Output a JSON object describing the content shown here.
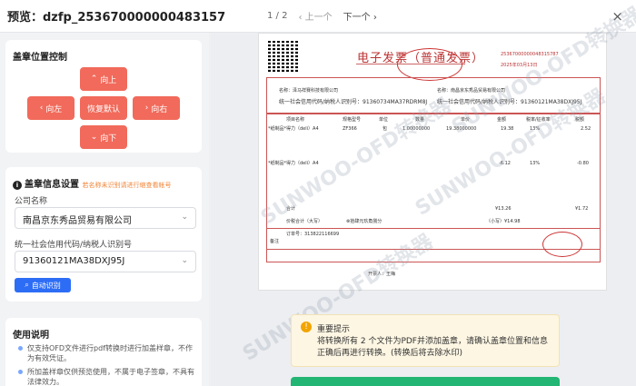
{
  "header": {
    "title": "预览：dzfp_25367000000048315787_南...",
    "page": "1 / 2",
    "prev": "‹ 上一个",
    "next": "下一个 ›",
    "close": "×"
  },
  "stamp_control": {
    "title": "盖章位置控制",
    "up": "向上",
    "left": "向左",
    "reset": "恢复默认",
    "right": "向右",
    "down": "向下"
  },
  "seal_info": {
    "title": "盖章信息设置",
    "hint": "若名称未识别请进行缩查看帐号",
    "company_label": "公司名称",
    "company_value": "南昌京东秀品贸易有限公司",
    "credit_label": "统一社会信用代码/纳税人识别号",
    "credit_value": "91360121MA38DXJ95J",
    "auto_label": "自动识别"
  },
  "instructions": {
    "title": "使用说明",
    "items": [
      "仅支持OFD文件进行pdf转换时进行加盖样章，不作为有效凭证。",
      "所加盖样章仅供预览使用，不属于电子签章，不具有法律效力。"
    ]
  },
  "invoice": {
    "title": "电子发票（普通发票）",
    "number": "25367000000048315787",
    "date": "2025年03月13日",
    "buyer_name": "名称：泽马祥赛科技有限公司",
    "buyer_tax": "统一社会信用代码/纳税人识别号：91360734MA37RDRM8J",
    "seller_name": "名称：南昌京东秀品贸易有限公司",
    "seller_tax": "统一社会信用代码/纳税人识别号：91360121MA38DXJ95J",
    "col_item": "项目名称",
    "col_spec": "规格型号",
    "col_unit": "单位",
    "col_qty": "数量",
    "col_price": "单价",
    "col_amount": "金额",
    "col_rate": "税率/征收率",
    "col_tax": "税额",
    "line1": "*纸制品*得力（deli）A4",
    "line1_spec": "ZF366",
    "line1_unit": "包",
    "line1_qty": "1.00000000",
    "line1_price": "19.38000000",
    "line1_amount": "19.38",
    "line1_rate": "13%",
    "line1_tax": "2.52",
    "line2": "*纸制品*得力（deli）A4",
    "line2_amount": "-6.12",
    "line2_rate": "13%",
    "line2_tax": "-0.80",
    "total_label": "合计",
    "total_amount": "¥13.26",
    "total_tax": "¥1.72",
    "sum_words_label": "价税合计（大写）",
    "sum_words": "⊗拾肆元玖角捌分",
    "sum_num": "（小写）¥14.98",
    "remark_label": "备注",
    "order": "订单号：313822116699",
    "drawer": "开票人：王梅"
  },
  "notice": {
    "icon": "!",
    "title": "重要提示",
    "body": "将转换所有 2 个文件为PDF并添加盖章，请确认盖章位置和信息正确后再进行转换。(转换后将去除水印)"
  },
  "watermark": "SUNWOO-OFD转换器",
  "colors": {
    "accent": "#f16a5b",
    "primary": "#2d6df6",
    "seal": "#c33333",
    "notice_bg": "#fdf6e3",
    "success": "#22b573"
  }
}
